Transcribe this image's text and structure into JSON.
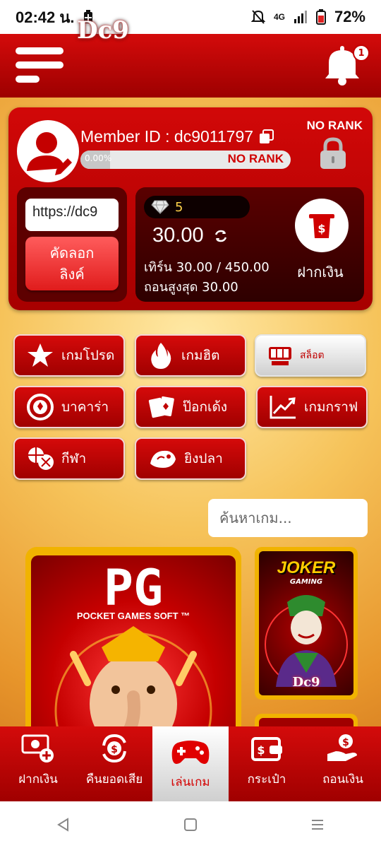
{
  "status": {
    "time": "02:42 น.",
    "battery": "72%",
    "network": "4G"
  },
  "header": {
    "logo": "Dc9",
    "notification_count": "1"
  },
  "member": {
    "id_label": "Member ID : dc9011797",
    "rank_top": "NO RANK",
    "rank_bar_text": "NO RANK",
    "rank_progress_pct": "0.00%",
    "rank_progress_fraction": 0.14
  },
  "referral": {
    "link_value": "https://dc9",
    "copy_button": "คัดลอก\nลิงค์"
  },
  "wallet": {
    "gems": "5",
    "balance": "30.00",
    "turnover": "เทิร์น 30.00 / 450.00",
    "max_withdraw": "ถอนสูงสุด 30.00",
    "deposit_label": "ฝากเงิน"
  },
  "categories": [
    {
      "label": "เกมโปรด",
      "icon": "star-icon"
    },
    {
      "label": "เกมฮิต",
      "icon": "fire-icon"
    },
    {
      "label": "สล็อต",
      "icon": "slot-machine-icon"
    },
    {
      "label": "บาคาร่า",
      "icon": "casino-chip-icon"
    },
    {
      "label": "ป๊อกเด้ง",
      "icon": "playing-cards-icon"
    },
    {
      "label": "เกมกราฟ",
      "icon": "trend-graph-icon"
    },
    {
      "label": "กีฬา",
      "icon": "sports-balls-icon"
    },
    {
      "label": "ยิงปลา",
      "icon": "fish-icon"
    }
  ],
  "search": {
    "placeholder": "ค้นหาเกม..."
  },
  "providers": {
    "pg_logo": "PG",
    "pg_sub": "POCKET GAMES SOFT ™",
    "joker_title": "JOKER",
    "joker_sub": "GAMING",
    "joker_badge": "Dc9"
  },
  "bottom_nav": [
    {
      "label": "ฝากเงิน",
      "icon": "deposit-cash-icon"
    },
    {
      "label": "คืนยอดเสีย",
      "icon": "cashback-icon"
    },
    {
      "label": "เล่นเกม",
      "icon": "gamepad-icon"
    },
    {
      "label": "กระเป๋า",
      "icon": "wallet-icon"
    },
    {
      "label": "ถอนเงิน",
      "icon": "withdraw-icon"
    }
  ],
  "colors": {
    "primary_red": "#d40b0b",
    "dark_red": "#5d0000",
    "gold": "#f1b300"
  }
}
